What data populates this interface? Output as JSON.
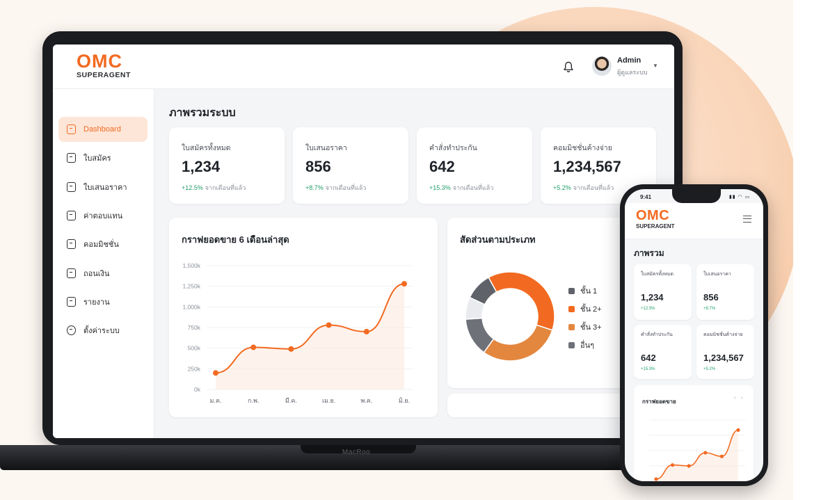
{
  "colors": {
    "accent": "#f26a21",
    "accent_light": "#fde6d8",
    "positive": "#22a06b",
    "dark": "#1f2329"
  },
  "laptop": {
    "brand": "MacRoo",
    "logo": {
      "main": "OMC",
      "sub": "SUPERAGENT"
    },
    "header": {
      "notification_icon": "bell-icon",
      "user_name": "Admin",
      "user_role": "ผู้ดูแลระบบ"
    },
    "sidebar": {
      "items": [
        {
          "label": "Dashboard",
          "icon": "dashboard-icon",
          "active": true
        },
        {
          "label": "ใบสมัคร",
          "icon": "document-icon",
          "active": false
        },
        {
          "label": "ใบเสนอราคา",
          "icon": "quote-icon",
          "active": false
        },
        {
          "label": "ค่าตอบแทน",
          "icon": "wallet-icon",
          "active": false
        },
        {
          "label": "คอมมิชชั่น",
          "icon": "commission-icon",
          "active": false
        },
        {
          "label": "ถอนเงิน",
          "icon": "withdraw-icon",
          "active": false
        },
        {
          "label": "รายงาน",
          "icon": "report-icon",
          "active": false
        },
        {
          "label": "ตั้งค่าระบบ",
          "icon": "settings-icon",
          "active": false
        }
      ]
    },
    "page_title": "ภาพรวมระบบ",
    "stats": [
      {
        "label": "ใบสมัครทั้งหมด",
        "value": "1,234",
        "change": "+12.5%",
        "change_text": "จากเดือนที่แล้ว"
      },
      {
        "label": "ใบเสนอราคา",
        "value": "856",
        "change": "+8.7%",
        "change_text": "จากเดือนที่แล้ว"
      },
      {
        "label": "คำสั่งทำประกัน",
        "value": "642",
        "change": "+15.3%",
        "change_text": "จากเดือนที่แล้ว"
      },
      {
        "label": "คอมมิชชั่นค้างจ่าย",
        "value": "1,234,567",
        "change": "+5.2%",
        "change_text": "จากเดือนที่แล้ว"
      }
    ],
    "sales_panel": {
      "title": "กราฟยอดขาย 6 เดือนล่าสุด"
    },
    "share_panel": {
      "title": "สัดส่วนตามประเภท"
    }
  },
  "chart_data": [
    {
      "type": "line",
      "title": "กราฟยอดขาย 6 เดือนล่าสุด",
      "categories": [
        "ม.ค.",
        "ก.พ.",
        "มี.ค.",
        "เม.ย.",
        "พ.ค.",
        "มิ.ย."
      ],
      "values": [
        200,
        510,
        490,
        780,
        700,
        1280
      ],
      "y_ticks": [
        "0k",
        "250k",
        "500k",
        "750k",
        "1,000k",
        "1,250k",
        "1,500k"
      ],
      "ylim": [
        0,
        1500
      ],
      "grid": true,
      "color": "#f26a21"
    },
    {
      "type": "pie",
      "title": "สัดส่วนตามประเภท",
      "legend_position": "right",
      "slices": [
        {
          "label": "ชั้น 1",
          "value": 10,
          "color": "#5f6268"
        },
        {
          "label": "ชั้น 2+",
          "value": 38,
          "color": "#f26a21"
        },
        {
          "label": "ชั้น 3+",
          "value": 30,
          "color": "#e3873f"
        },
        {
          "label": "อื่นๆ",
          "value": 14,
          "color": "#6e7178"
        },
        {
          "label": "",
          "value": 8,
          "color": "#e9ebee"
        }
      ]
    }
  ],
  "phone": {
    "time": "9:41",
    "status": "▮▮ ◠ ▭",
    "logo": {
      "main": "OMC",
      "sub": "SUPERAGENT"
    },
    "title": "ภาพรวม",
    "cards": [
      {
        "label": "ใบสมัครทั้งหมด",
        "value": "1,234",
        "change": "+12.5%"
      },
      {
        "label": "ใบเสนอราคา",
        "value": "856",
        "change": "+8.7%"
      },
      {
        "label": "คำสั่งทำประกัน",
        "value": "642",
        "change": "+15.3%"
      },
      {
        "label": "คอมมิชชั่นค้างจ่าย",
        "value": "1,234,567",
        "change": "+5.2%"
      }
    ],
    "chart_title": "กราฟยอดขาย",
    "chart_controls": "‹ ›"
  }
}
